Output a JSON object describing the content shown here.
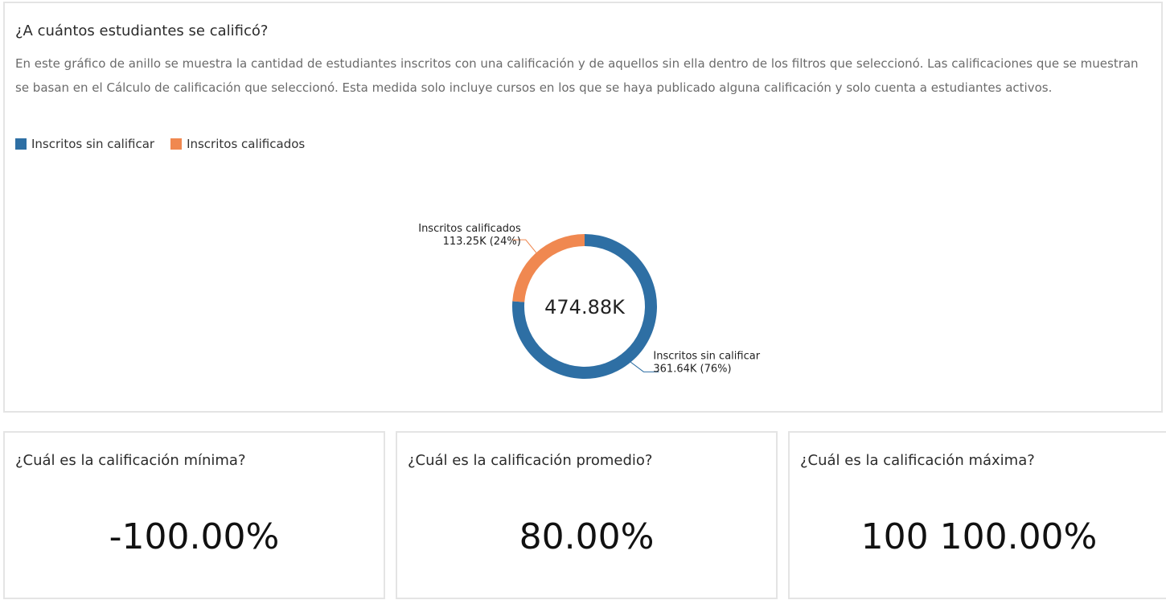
{
  "main": {
    "title": "¿A cuántos estudiantes se calificó?",
    "description": "En este gráfico de anillo se muestra la cantidad de estudiantes inscritos con una calificación y de aquellos sin ella dentro de los filtros que seleccionó. Las calificaciones que se muestran se basan en el Cálculo de calificación que seleccionó. Esta medida solo incluye cursos en los que se haya publicado alguna calificación y solo cuenta a estudiantes activos."
  },
  "chart_data": {
    "type": "pie",
    "variant": "donut",
    "center_label": "474.88K",
    "legend": [
      "Inscritos sin calificar",
      "Inscritos calificados"
    ],
    "legend_placement": "top-left",
    "slices": [
      {
        "name": "Inscritos sin calificar",
        "value": 361.64,
        "value_label": "361.64K (76%)",
        "color": "#2e6fa4"
      },
      {
        "name": "Inscritos calificados",
        "value": 113.25,
        "value_label": "113.25K (24%)",
        "color": "#f08850"
      }
    ]
  },
  "stats": [
    {
      "title": "¿Cuál es la calificación mínima?",
      "value": "-100.00%"
    },
    {
      "title": "¿Cuál es la calificación promedio?",
      "value": "80.00%"
    },
    {
      "title": "¿Cuál es la calificación máxima?",
      "value": "100 100.00%"
    }
  ]
}
